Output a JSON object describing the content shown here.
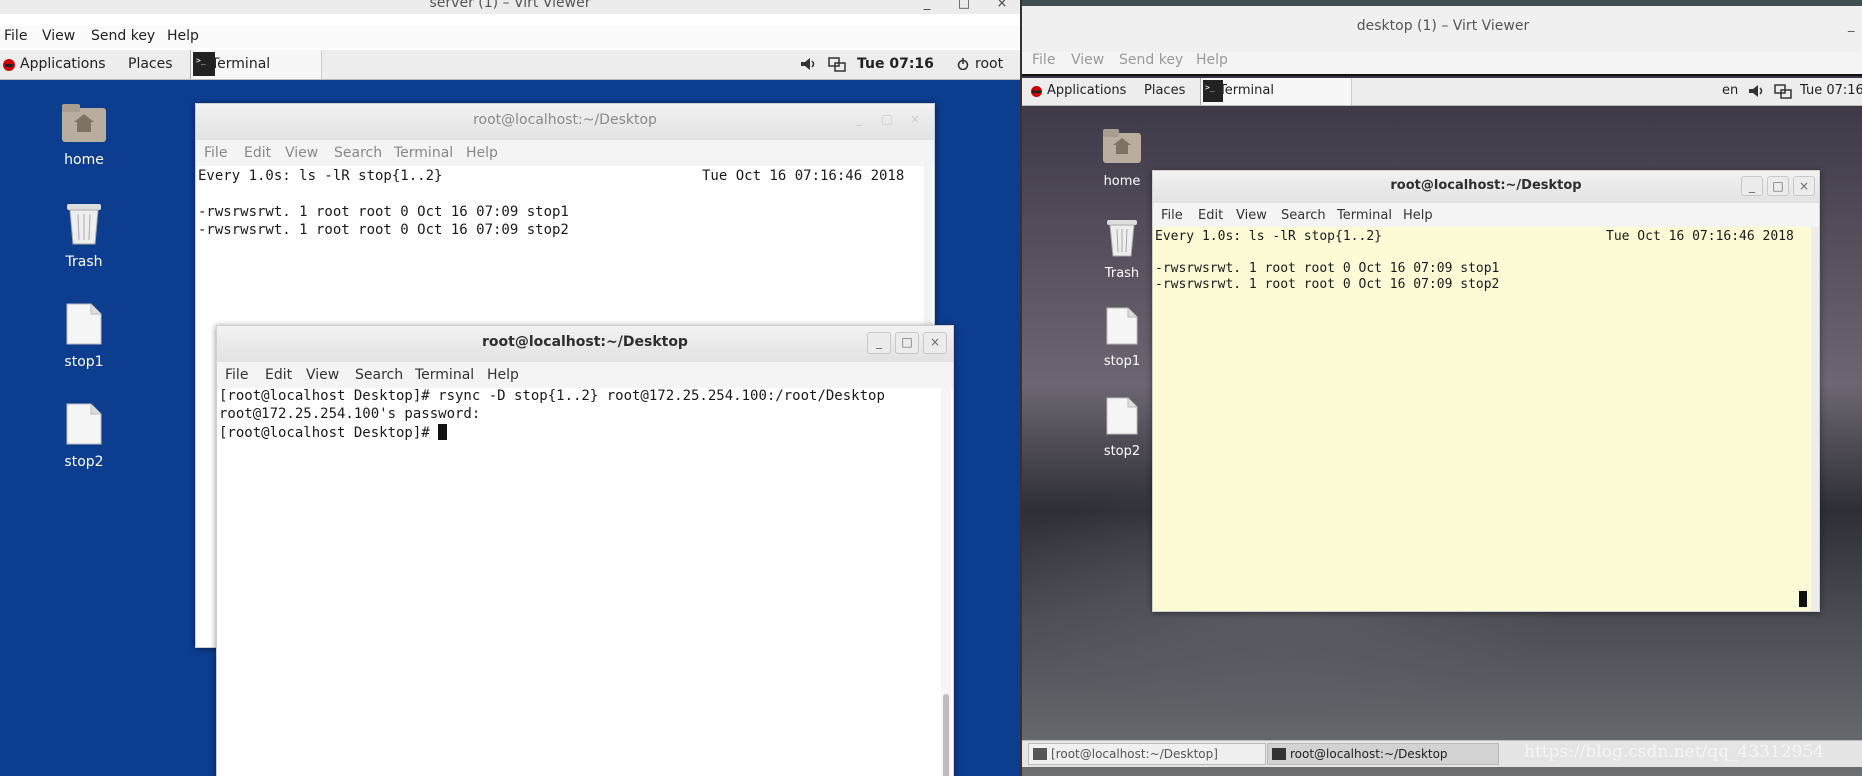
{
  "left_viewer": {
    "title": "server (1) – Virt Viewer",
    "window_controls": [
      "_",
      "□",
      "×"
    ],
    "menu": [
      "File",
      "View",
      "Send key",
      "Help"
    ],
    "top_bar": {
      "applications": "Applications",
      "places": "Places",
      "terminal_tab": "Terminal",
      "clock": "Tue 07:16",
      "user": "root"
    },
    "desktop_icons": [
      {
        "label": "home",
        "icon": "home-folder-icon"
      },
      {
        "label": "Trash",
        "icon": "trash-icon"
      },
      {
        "label": "stop1",
        "icon": "file-icon"
      },
      {
        "label": "stop2",
        "icon": "file-icon"
      }
    ],
    "watch_window": {
      "title": "root@localhost:~/Desktop",
      "menu": [
        "File",
        "Edit",
        "View",
        "Search",
        "Terminal",
        "Help"
      ],
      "header": "Every 1.0s: ls -lR stop{1..2}",
      "timestamp": "Tue Oct 16 07:16:46 2018",
      "lines": [
        "-rwsrwsrwt. 1 root root 0 Oct 16 07:09 stop1",
        "-rwsrwsrwt. 1 root root 0 Oct 16 07:09 stop2"
      ]
    },
    "rsync_window": {
      "title": "root@localhost:~/Desktop",
      "menu": [
        "File",
        "Edit",
        "View",
        "Search",
        "Terminal",
        "Help"
      ],
      "lines": [
        "[root@localhost Desktop]# rsync -D stop{1..2} root@172.25.254.100:/root/Desktop",
        "root@172.25.254.100's password:",
        "[root@localhost Desktop]# "
      ]
    }
  },
  "right_viewer": {
    "title": "desktop (1) – Virt Viewer",
    "menu": [
      "File",
      "View",
      "Send key",
      "Help"
    ],
    "top_bar": {
      "applications": "Applications",
      "places": "Places",
      "terminal_tab": "Terminal",
      "lang": "en",
      "clock": "Tue 07:16"
    },
    "desktop_icons": [
      {
        "label": "home",
        "icon": "home-folder-icon"
      },
      {
        "label": "Trash",
        "icon": "trash-icon"
      },
      {
        "label": "stop1",
        "icon": "file-icon"
      },
      {
        "label": "stop2",
        "icon": "file-icon"
      }
    ],
    "terminal_window": {
      "title": "root@localhost:~/Desktop",
      "menu": [
        "File",
        "Edit",
        "View",
        "Search",
        "Terminal",
        "Help"
      ],
      "header": "Every 1.0s: ls -lR stop{1..2}",
      "timestamp": "Tue Oct 16 07:16:46 2018",
      "lines": [
        "-rwsrwsrwt. 1 root root 0 Oct 16 07:09 stop1",
        "-rwsrwsrwt. 1 root root 0 Oct 16 07:09 stop2"
      ]
    },
    "taskbar": [
      "[root@localhost:~/Desktop]",
      "root@localhost:~/Desktop"
    ],
    "watermark": "https://blog.csdn.net/qq_43312954"
  },
  "colors": {
    "left_desktop_bg": "#0c3d8f",
    "right_terminal_bg": "#fdfbd6",
    "gnome_bar": "#ededed"
  }
}
